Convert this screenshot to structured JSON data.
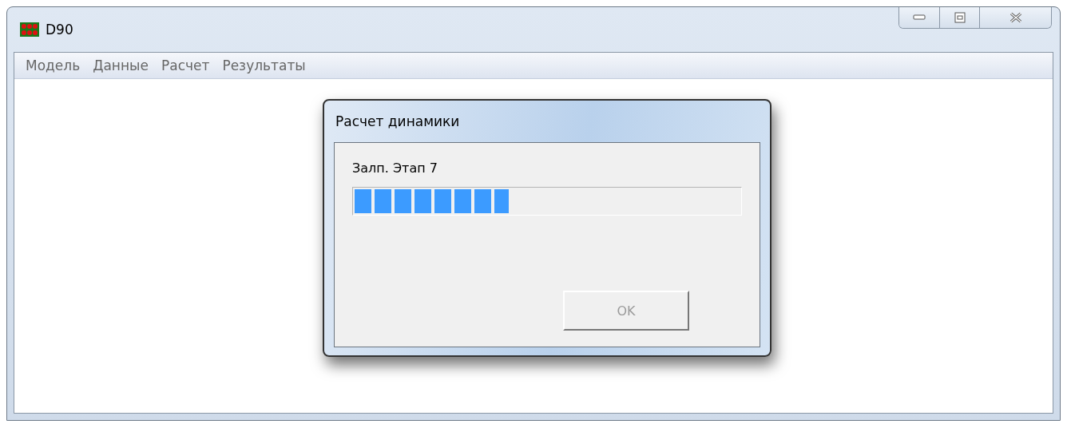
{
  "window": {
    "title": "D90"
  },
  "menu": [
    "Модель",
    "Данные",
    "Расчет",
    "Результаты"
  ],
  "dialog": {
    "title": "Расчет динамики",
    "status": "Залп. Этап 7",
    "progress": {
      "level": 0.4
    },
    "button": {
      "label": "OK",
      "disabled": true
    }
  }
}
